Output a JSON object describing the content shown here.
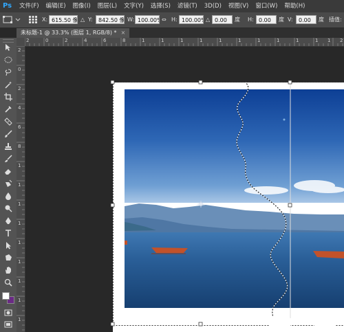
{
  "app": {
    "logo": "Ps"
  },
  "menu": [
    "文件(F)",
    "编辑(E)",
    "图像(I)",
    "图层(L)",
    "文字(Y)",
    "选择(S)",
    "滤镜(T)",
    "3D(D)",
    "视图(V)",
    "窗口(W)",
    "帮助(H)"
  ],
  "options": {
    "x_label": "X:",
    "x_value": "615.50 像",
    "y_label": "Y:",
    "y_value": "842.50 像",
    "w_label": "W:",
    "w_value": "100.00%",
    "h_label": "H:",
    "h_value": "100.00%",
    "angle_value": "0.00",
    "deg": "度",
    "hskew_label": "H:",
    "hskew_value": "0.00",
    "vskew_label": "V:",
    "vskew_value": "0.00",
    "interp_label": "插值:"
  },
  "document": {
    "tab_title": "未标题-1 @ 33.3% (图层 1, RGB/8) *",
    "close": "×"
  },
  "ruler": {
    "h_labels": [
      "2",
      "0",
      "2",
      "4",
      "6",
      "8",
      "1",
      "1",
      "1",
      "1",
      "1",
      "1",
      "1",
      "1",
      "1",
      "1",
      "1",
      "2"
    ],
    "v_labels": [
      "2",
      "0",
      "2",
      "4",
      "6",
      "8",
      "1",
      "1",
      "1",
      "1",
      "1",
      "1",
      "1",
      "1",
      "1"
    ]
  },
  "colors": {
    "foreground": "#ffffff",
    "background": "#6a2a85",
    "sky_top": "#0d3f95",
    "lake": "#1e4c7e"
  },
  "tools": [
    "move-icon",
    "marquee-icon",
    "lasso-icon",
    "magic-wand-icon",
    "crop-icon",
    "eyedropper-icon",
    "healing-icon",
    "brush-icon",
    "stamp-icon",
    "history-brush-icon",
    "eraser-icon",
    "gradient-icon",
    "blur-icon",
    "dodge-icon",
    "pen-icon",
    "type-icon",
    "path-select-icon",
    "shape-icon",
    "hand-icon",
    "zoom-icon"
  ]
}
